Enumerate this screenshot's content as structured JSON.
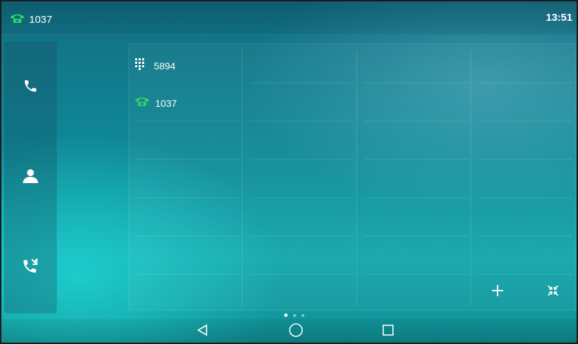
{
  "status_bar": {
    "line_icon": "green-handset-icon",
    "line_number": "1037",
    "time": "13:51"
  },
  "sidebar": {
    "items": [
      {
        "name": "phone-icon"
      },
      {
        "name": "contacts-icon"
      },
      {
        "name": "call-history-icon"
      }
    ]
  },
  "dsskeys": [
    {
      "icon": "dialpad-icon",
      "label": "5894"
    },
    {
      "icon": "green-handset-icon",
      "label": "1037"
    }
  ],
  "panel_buttons": {
    "add": "add-icon",
    "collapse": "collapse-icon"
  },
  "pagination": {
    "current_page": 1,
    "total_pages": 3
  },
  "nav": {
    "back": "back-icon",
    "home": "home-icon",
    "recents": "recents-icon"
  },
  "colors": {
    "handset_green": "#2fd36b",
    "accent": "#12a7ac"
  }
}
